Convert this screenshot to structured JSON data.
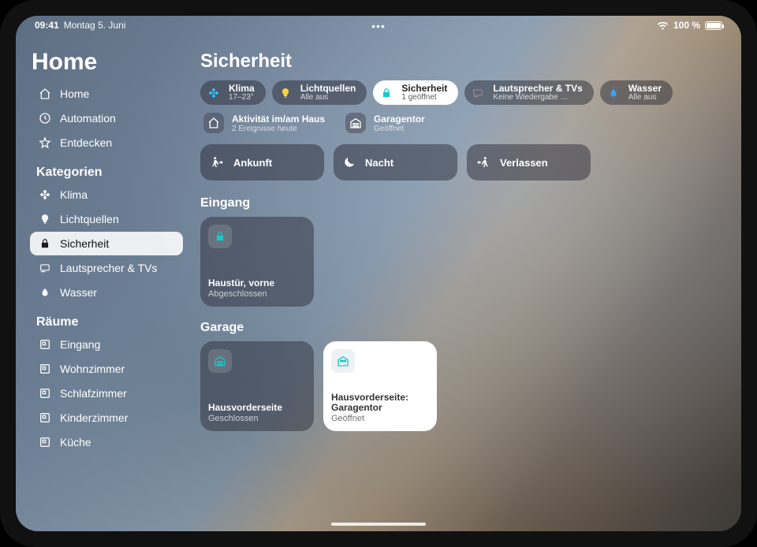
{
  "statusbar": {
    "time": "09:41",
    "date": "Montag 5. Juni",
    "battery_text": "100 %"
  },
  "sidebar": {
    "title": "Home",
    "nav": [
      {
        "label": "Home"
      },
      {
        "label": "Automation"
      },
      {
        "label": "Entdecken"
      }
    ],
    "cat_header": "Kategorien",
    "categories": [
      {
        "label": "Klima"
      },
      {
        "label": "Lichtquellen"
      },
      {
        "label": "Sicherheit"
      },
      {
        "label": "Lautsprecher & TVs"
      },
      {
        "label": "Wasser"
      }
    ],
    "rooms_header": "Räume",
    "rooms": [
      {
        "label": "Eingang"
      },
      {
        "label": "Wohnzimmer"
      },
      {
        "label": "Schlafzimmer"
      },
      {
        "label": "Kinderzimmer"
      },
      {
        "label": "Küche"
      }
    ]
  },
  "main": {
    "title": "Sicherheit",
    "pills": [
      {
        "title": "Klima",
        "sub": "17–23°",
        "icon": "fan",
        "color": "#2bc0ff"
      },
      {
        "title": "Lichtquellen",
        "sub": "Alle aus",
        "icon": "bulb",
        "color": "#ffd23b"
      },
      {
        "title": "Sicherheit",
        "sub": "1 geöffnet",
        "icon": "lock",
        "color": "#18c9c9",
        "active": true
      },
      {
        "title": "Lautsprecher & TVs",
        "sub": "Keine Wiedergabe …",
        "icon": "tv",
        "color": "#8e8e93"
      },
      {
        "title": "Wasser",
        "sub": "Alle aus",
        "icon": "drop",
        "color": "#2ea7ff"
      }
    ],
    "status": [
      {
        "title": "Aktivität im/am Haus",
        "sub": "2 Ereignisse heute",
        "icon": "house"
      },
      {
        "title": "Garagentor",
        "sub": "Geöffnet",
        "icon": "garage"
      }
    ],
    "scenes": [
      {
        "label": "Ankunft",
        "icon": "arrive"
      },
      {
        "label": "Nacht",
        "icon": "moon"
      },
      {
        "label": "Verlassen",
        "icon": "leave"
      }
    ],
    "groups": [
      {
        "header": "Eingang",
        "tiles": [
          {
            "title": "Haustür, vorne",
            "sub": "Abgeschlossen",
            "icon": "lock",
            "variant": "dark",
            "iconColor": "#18c9c9"
          }
        ]
      },
      {
        "header": "Garage",
        "tiles": [
          {
            "title": "Hausvorderseite",
            "sub": "Geschlossen",
            "icon": "garage",
            "variant": "dark",
            "iconColor": "#18c9c9"
          },
          {
            "title": "Hausvorderseite: Garagentor",
            "sub": "Geöffnet",
            "icon": "garage-open",
            "variant": "light",
            "iconColor": "#18c9c9"
          }
        ]
      }
    ]
  }
}
